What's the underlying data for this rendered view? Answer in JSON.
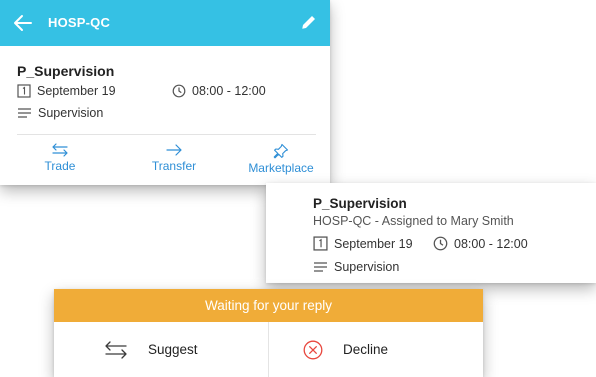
{
  "top_card": {
    "header_title": "HOSP-QC",
    "shift_title": "P_Supervision",
    "date": "September 19",
    "time": "08:00 - 12:00",
    "description": "Supervision",
    "actions": [
      {
        "label": "Trade",
        "icon": "swap-icon"
      },
      {
        "label": "Transfer",
        "icon": "arrow-right-icon"
      },
      {
        "label": "Marketplace",
        "icon": "pin-icon"
      }
    ]
  },
  "detail_card": {
    "shift_title": "P_Supervision",
    "subtitle": "HOSP-QC - Assigned to Mary Smith",
    "date": "September 19",
    "time": "08:00 - 12:00",
    "description": "Supervision"
  },
  "reply_card": {
    "banner": "Waiting for your reply",
    "suggest_label": "Suggest",
    "decline_label": "Decline"
  },
  "colors": {
    "header": "#35c1e4",
    "action_blue": "#2f8fd6",
    "banner_orange": "#f0ac38",
    "decline_red": "#e8473e"
  }
}
